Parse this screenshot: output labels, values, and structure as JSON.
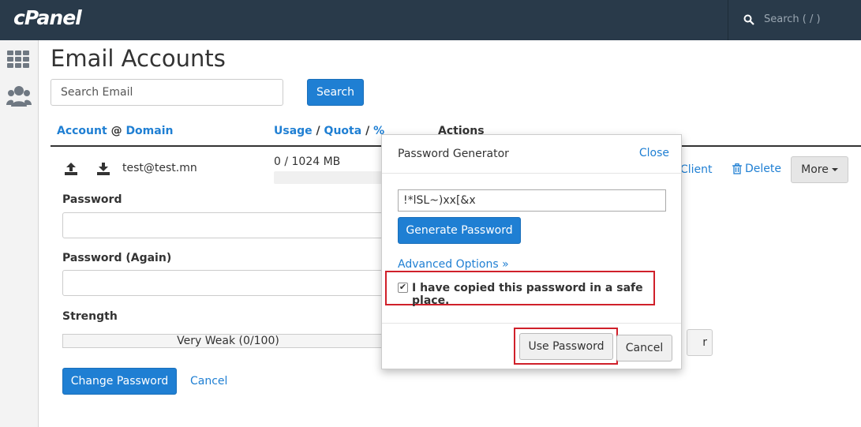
{
  "app": {
    "logo": "cPanel"
  },
  "topbar": {
    "search_placeholder": "Search ( / )"
  },
  "page": {
    "title": "Email Accounts"
  },
  "search": {
    "placeholder": "Search Email",
    "button_label": "Search"
  },
  "table": {
    "headers": {
      "account": "Account",
      "at": "@",
      "domain": "Domain",
      "usage": "Usage",
      "sep1": "/",
      "quota": "Quota",
      "sep2": "/",
      "percent": "%",
      "actions": "Actions"
    },
    "row": {
      "email": "test@test.mn",
      "usage": "0 / 1024 MB",
      "client_label": "Client",
      "delete_label": "Delete",
      "more_label": "More"
    }
  },
  "password_form": {
    "password_label": "Password",
    "password_again_label": "Password (Again)",
    "strength_label": "Strength",
    "strength_value": "Very Weak (0/100)",
    "change_button": "Change Password",
    "cancel_link": "Cancel",
    "partial_button_text": "r"
  },
  "generator": {
    "title": "Password Generator",
    "close_label": "Close",
    "generated_password": "!*lSL~)xx[&x",
    "generate_button": "Generate Password",
    "advanced_link": "Advanced Options »",
    "copied_checkbox_label": "I have copied this password in a safe place.",
    "copied_checked": true,
    "use_button": "Use Password",
    "cancel_button": "Cancel"
  },
  "colors": {
    "topbar": "#293a4a",
    "accent": "#1f7fd3",
    "highlight": "#d0202a"
  }
}
